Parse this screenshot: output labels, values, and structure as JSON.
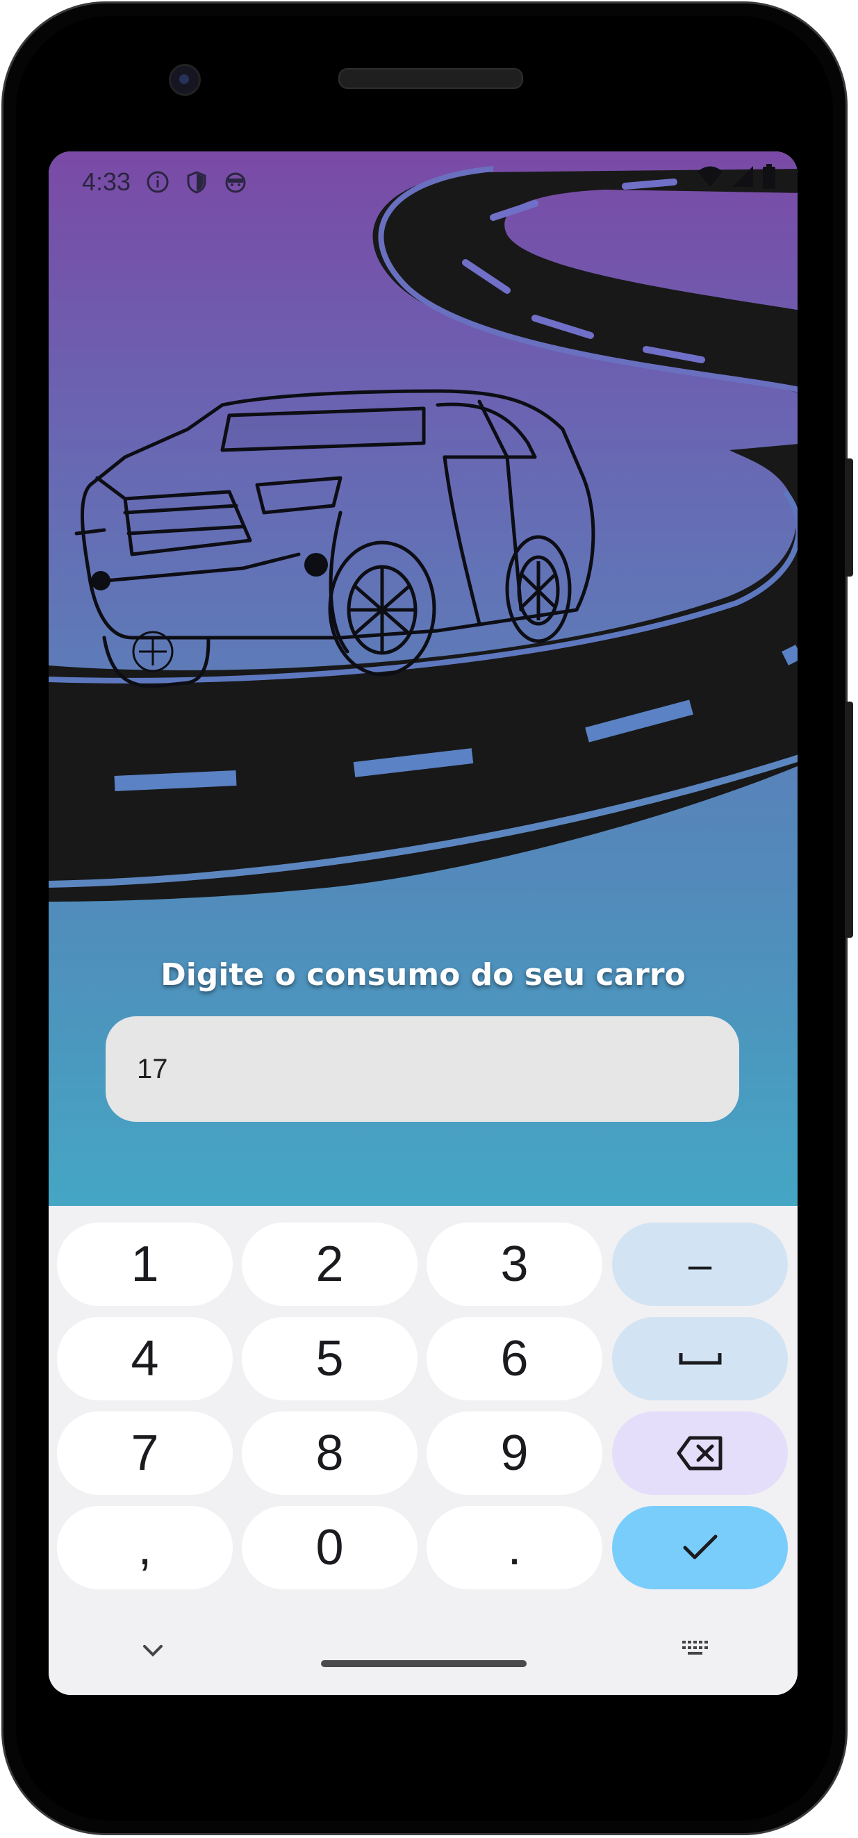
{
  "status_bar": {
    "time": "4:33"
  },
  "app": {
    "prompt": "Digite o consumo do seu carro",
    "input_value": "17"
  },
  "keyboard": {
    "rows": [
      [
        "1",
        "2",
        "3",
        "–"
      ],
      [
        "4",
        "5",
        "6",
        ""
      ],
      [
        "7",
        "8",
        "9",
        ""
      ],
      [
        ",",
        "0",
        ".",
        ""
      ]
    ],
    "special_keys": {
      "dash": "–",
      "space": "space-icon",
      "backspace": "backspace-icon",
      "enter": "check-icon",
      "hide": "chevron-down-icon",
      "layout": "keyboard-icon"
    }
  },
  "colors": {
    "gradient_top": "#7a4aa6",
    "gradient_bottom": "#45a6c4",
    "road": "#181818",
    "keyboard_bg": "#f1f0f3",
    "enter_key": "#79cdfb",
    "fn_key": "#d2e4f3",
    "backspace_key": "#e5defa"
  }
}
